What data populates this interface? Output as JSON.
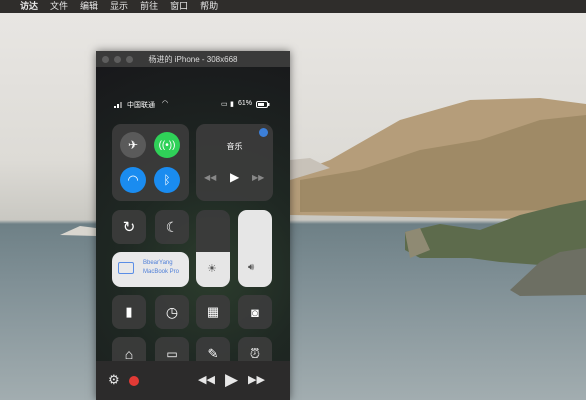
{
  "menubar": {
    "apple": "",
    "items": [
      "访达",
      "文件",
      "编辑",
      "显示",
      "前往",
      "窗口",
      "帮助"
    ]
  },
  "window": {
    "title": "杨进的 iPhone - 308x668"
  },
  "phone": {
    "carrier": "中国联通",
    "battery": "61%",
    "music": {
      "title": "音乐"
    },
    "airplay": {
      "line1": "BbearYang",
      "line2": "MacBook Pro"
    }
  },
  "colors": {
    "cellular_green": "#2fd158",
    "wifi_blue": "#1a8cf0",
    "record_red": "#e23a35",
    "menubar_bg": "#2f2d2b"
  },
  "icons": {
    "airplane": "airplane-icon",
    "cellular": "cellular-data-icon",
    "wifi": "wifi-icon",
    "bluetooth": "bluetooth-icon"
  }
}
